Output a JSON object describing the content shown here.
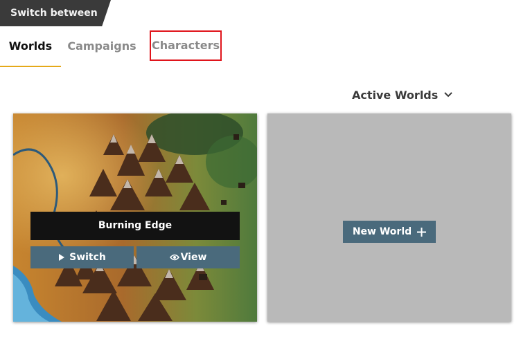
{
  "header": {
    "title": "Switch between"
  },
  "tabs": [
    {
      "label": "Worlds",
      "active": true
    },
    {
      "label": "Campaigns",
      "active": false
    },
    {
      "label": "Characters",
      "active": false,
      "highlighted": true
    }
  ],
  "filter": {
    "label": "Active Worlds",
    "icon": "chevron-down-icon"
  },
  "world_card": {
    "title": "Burning Edge",
    "switch_label": "Switch",
    "view_label": "View",
    "switch_icon": "play-icon",
    "view_icon": "eye-icon"
  },
  "new_card": {
    "button_label": "New World",
    "icon": "plus-icon"
  },
  "colors": {
    "accent_underline": "#e5a91a",
    "button": "#4a6a7c",
    "highlight_border": "#e0141b",
    "header_bg": "#3a3a3a",
    "placeholder_card": "#b9b9b9"
  }
}
